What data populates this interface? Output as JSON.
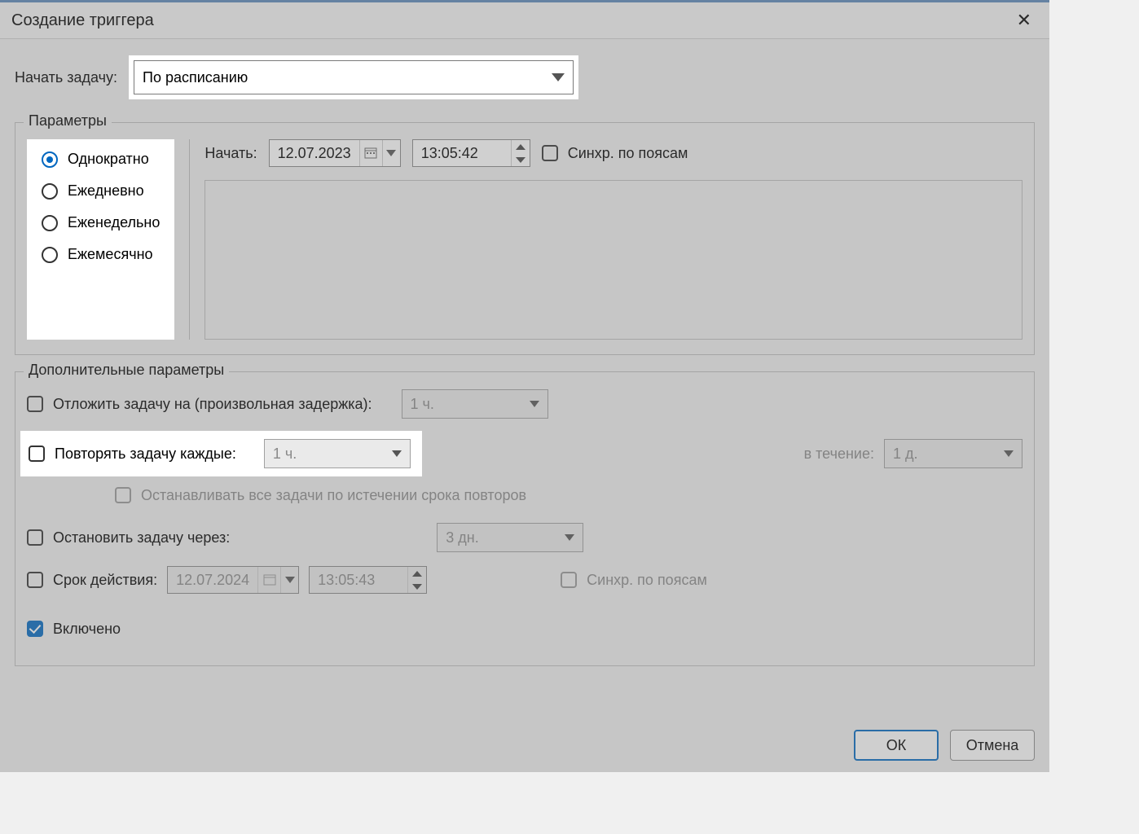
{
  "title": "Создание триггера",
  "begin_label": "Начать задачу:",
  "begin_value": "По расписанию",
  "group_params": "Параметры",
  "group_adv": "Дополнительные параметры",
  "radios": {
    "once": "Однократно",
    "daily": "Ежедневно",
    "weekly": "Еженедельно",
    "monthly": "Ежемесячно"
  },
  "start_label": "Начать:",
  "start_date": "12.07.2023",
  "start_time": "13:05:42",
  "sync_tz": "Синхр. по поясам",
  "adv": {
    "delay_label": "Отложить задачу на (произвольная задержка):",
    "delay_value": "1 ч.",
    "repeat_label": "Повторять задачу каждые:",
    "repeat_value": "1 ч.",
    "duration_label": "в течение:",
    "duration_value": "1 д.",
    "stop_all": "Останавливать все задачи по истечении срока повторов",
    "stop_after_label": "Остановить задачу через:",
    "stop_after_value": "3 дн.",
    "expire_label": "Срок действия:",
    "expire_date": "12.07.2024",
    "expire_time": "13:05:43",
    "expire_sync": "Синхр. по поясам",
    "enabled": "Включено"
  },
  "buttons": {
    "ok": "ОК",
    "cancel": "Отмена"
  }
}
